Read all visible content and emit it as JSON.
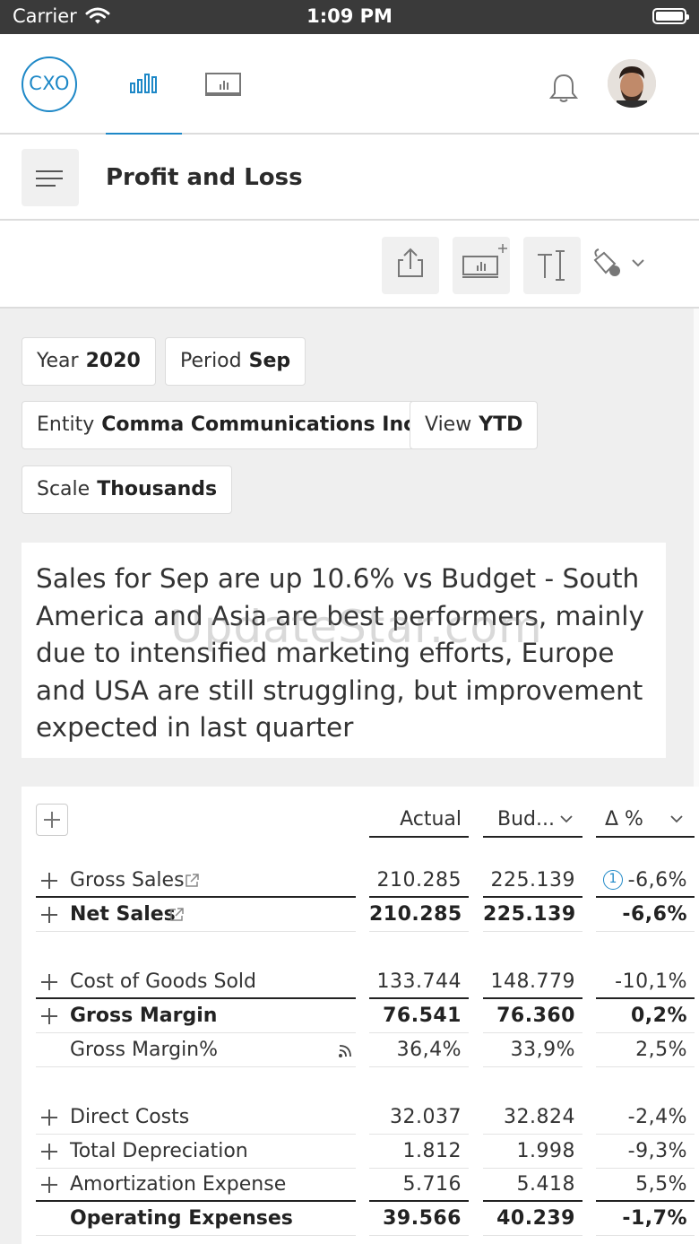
{
  "status_bar": {
    "carrier": "Carrier",
    "time": "1:09 PM"
  },
  "nav": {
    "logo_text": "CXO",
    "active_tab": "charts"
  },
  "title": "Profit and Loss",
  "filters": {
    "year": {
      "label": "Year",
      "value": "2020"
    },
    "period": {
      "label": "Period",
      "value": "Sep"
    },
    "entity": {
      "label": "Entity",
      "value": "Comma Communications Inc."
    },
    "view": {
      "label": "View",
      "value": "YTD"
    },
    "scale": {
      "label": "Scale",
      "value": "Thousands"
    }
  },
  "comment": "Sales for Sep are up 10.6% vs Budget - South America and Asia are best performers, mainly due to intensified marketing efforts, Europe and USA are still struggling, but improvement expected in last quarter",
  "watermark": "UpdateStar.com",
  "table": {
    "columns": {
      "actual": "Actual",
      "budget": "Bud...",
      "delta": "Δ %"
    },
    "rows": [
      {
        "label": "Gross Sales",
        "actual": "210.285",
        "budget": "225.139",
        "delta": "-6,6%",
        "info": "1"
      },
      {
        "label": "Net Sales",
        "actual": "210.285",
        "budget": "225.139",
        "delta": "-6,6%"
      },
      {
        "label": "Cost of Goods Sold",
        "actual": "133.744",
        "budget": "148.779",
        "delta": "-10,1%"
      },
      {
        "label": "Gross Margin",
        "actual": "76.541",
        "budget": "76.360",
        "delta": "0,2%"
      },
      {
        "label": "Gross Margin%",
        "actual": "36,4%",
        "budget": "33,9%",
        "delta": "2,5%"
      },
      {
        "label": "Direct Costs",
        "actual": "32.037",
        "budget": "32.824",
        "delta": "-2,4%"
      },
      {
        "label": "Total Depreciation",
        "actual": "1.812",
        "budget": "1.998",
        "delta": "-9,3%"
      },
      {
        "label": "Amortization Expense",
        "actual": "5.716",
        "budget": "5.418",
        "delta": "5,5%"
      },
      {
        "label": "Operating Expenses",
        "actual": "39.566",
        "budget": "40.239",
        "delta": "-1,7%"
      }
    ]
  },
  "colors": {
    "accent": "#1e88c7",
    "background": "#efefef",
    "status_bar": "#3a3a3a"
  }
}
